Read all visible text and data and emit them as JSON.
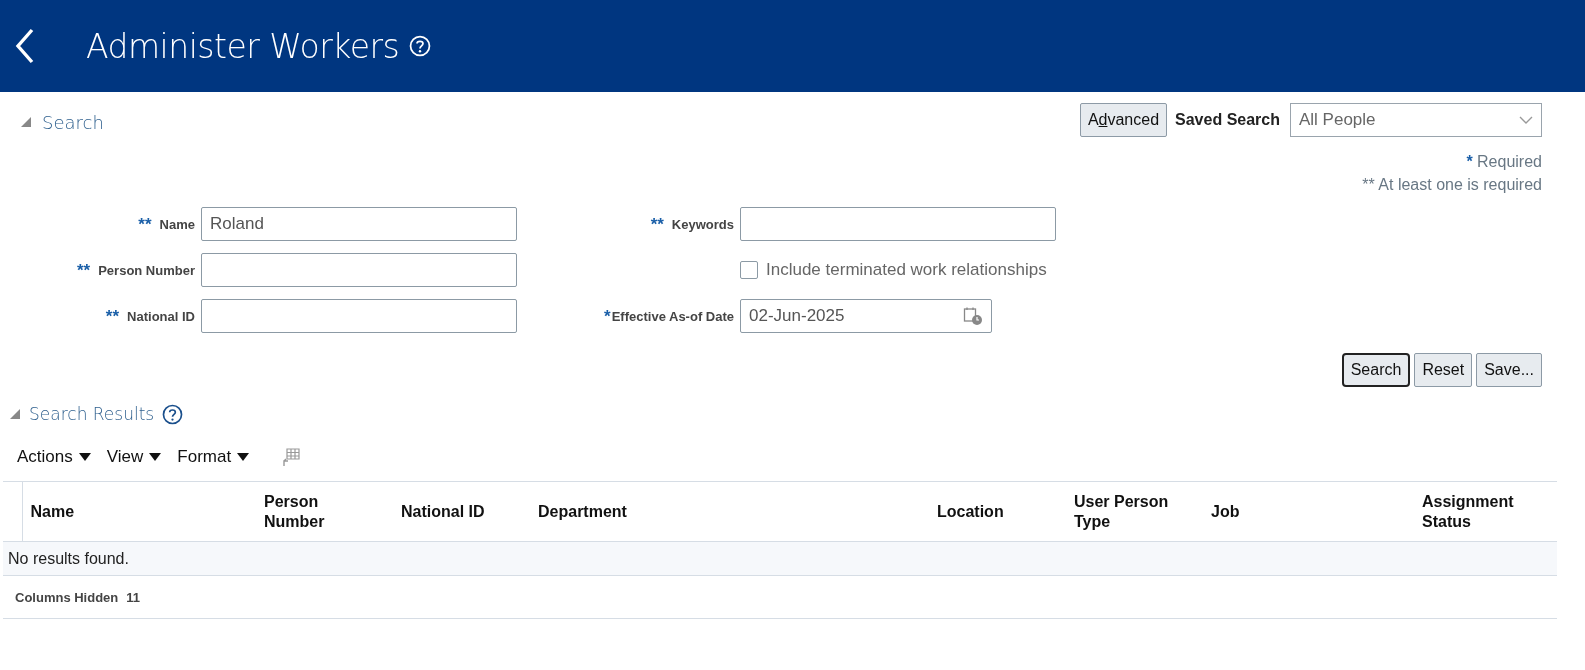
{
  "header": {
    "title": "Administer Workers"
  },
  "search": {
    "title": "Search",
    "expanded": true,
    "advanced_button": {
      "label_parts": [
        {
          "text": "A",
          "underline": false
        },
        {
          "text": "d",
          "underline": true
        },
        {
          "text": "vanced",
          "underline": false
        }
      ]
    },
    "saved_search": {
      "label": "Saved Search",
      "value": "All People"
    },
    "legend": [
      {
        "marker": "*",
        "text": "Required"
      },
      {
        "marker": "**",
        "text": "At least one is required"
      }
    ],
    "left_fields": [
      {
        "kind": "text",
        "marker": "**",
        "label": "Name",
        "value": "Roland"
      },
      {
        "kind": "text",
        "marker": "**",
        "label": "Person Number"
      },
      {
        "kind": "text",
        "marker": "**",
        "label": "National ID"
      }
    ],
    "right_fields": [
      {
        "kind": "text",
        "marker": "**",
        "label": "Keywords"
      },
      {
        "kind": "checkbox",
        "label": "Include terminated work relationships",
        "checked": false
      },
      {
        "kind": "date",
        "marker": "*",
        "label": "Effective As-of Date",
        "value": "02-Jun-2025"
      }
    ],
    "buttons": [
      {
        "label": "Search",
        "default": true
      },
      {
        "label": "Reset",
        "default": false
      },
      {
        "label": "Save..."
      }
    ]
  },
  "results": {
    "title": "Search Results",
    "expanded": true,
    "menus": [
      "Actions",
      "View",
      "Format"
    ],
    "columns": [
      "Name",
      "Person Number",
      "National ID",
      "Department",
      "Location",
      "User Person Type",
      "Job",
      "Assignment Status"
    ],
    "empty_message": "No results found.",
    "columns_hidden": {
      "label": "Columns Hidden",
      "count": "11"
    }
  }
}
